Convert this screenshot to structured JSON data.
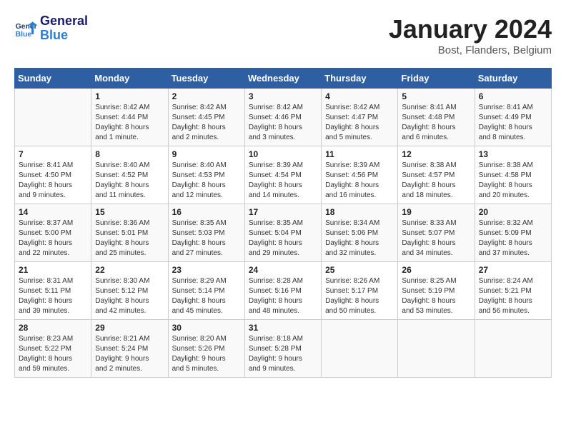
{
  "header": {
    "logo_line1": "General",
    "logo_line2": "Blue",
    "month_title": "January 2024",
    "subtitle": "Bost, Flanders, Belgium"
  },
  "days_of_week": [
    "Sunday",
    "Monday",
    "Tuesday",
    "Wednesday",
    "Thursday",
    "Friday",
    "Saturday"
  ],
  "weeks": [
    [
      {
        "day": "",
        "info": ""
      },
      {
        "day": "1",
        "info": "Sunrise: 8:42 AM\nSunset: 4:44 PM\nDaylight: 8 hours\nand 1 minute."
      },
      {
        "day": "2",
        "info": "Sunrise: 8:42 AM\nSunset: 4:45 PM\nDaylight: 8 hours\nand 2 minutes."
      },
      {
        "day": "3",
        "info": "Sunrise: 8:42 AM\nSunset: 4:46 PM\nDaylight: 8 hours\nand 3 minutes."
      },
      {
        "day": "4",
        "info": "Sunrise: 8:42 AM\nSunset: 4:47 PM\nDaylight: 8 hours\nand 5 minutes."
      },
      {
        "day": "5",
        "info": "Sunrise: 8:41 AM\nSunset: 4:48 PM\nDaylight: 8 hours\nand 6 minutes."
      },
      {
        "day": "6",
        "info": "Sunrise: 8:41 AM\nSunset: 4:49 PM\nDaylight: 8 hours\nand 8 minutes."
      }
    ],
    [
      {
        "day": "7",
        "info": "Sunrise: 8:41 AM\nSunset: 4:50 PM\nDaylight: 8 hours\nand 9 minutes."
      },
      {
        "day": "8",
        "info": "Sunrise: 8:40 AM\nSunset: 4:52 PM\nDaylight: 8 hours\nand 11 minutes."
      },
      {
        "day": "9",
        "info": "Sunrise: 8:40 AM\nSunset: 4:53 PM\nDaylight: 8 hours\nand 12 minutes."
      },
      {
        "day": "10",
        "info": "Sunrise: 8:39 AM\nSunset: 4:54 PM\nDaylight: 8 hours\nand 14 minutes."
      },
      {
        "day": "11",
        "info": "Sunrise: 8:39 AM\nSunset: 4:56 PM\nDaylight: 8 hours\nand 16 minutes."
      },
      {
        "day": "12",
        "info": "Sunrise: 8:38 AM\nSunset: 4:57 PM\nDaylight: 8 hours\nand 18 minutes."
      },
      {
        "day": "13",
        "info": "Sunrise: 8:38 AM\nSunset: 4:58 PM\nDaylight: 8 hours\nand 20 minutes."
      }
    ],
    [
      {
        "day": "14",
        "info": "Sunrise: 8:37 AM\nSunset: 5:00 PM\nDaylight: 8 hours\nand 22 minutes."
      },
      {
        "day": "15",
        "info": "Sunrise: 8:36 AM\nSunset: 5:01 PM\nDaylight: 8 hours\nand 25 minutes."
      },
      {
        "day": "16",
        "info": "Sunrise: 8:35 AM\nSunset: 5:03 PM\nDaylight: 8 hours\nand 27 minutes."
      },
      {
        "day": "17",
        "info": "Sunrise: 8:35 AM\nSunset: 5:04 PM\nDaylight: 8 hours\nand 29 minutes."
      },
      {
        "day": "18",
        "info": "Sunrise: 8:34 AM\nSunset: 5:06 PM\nDaylight: 8 hours\nand 32 minutes."
      },
      {
        "day": "19",
        "info": "Sunrise: 8:33 AM\nSunset: 5:07 PM\nDaylight: 8 hours\nand 34 minutes."
      },
      {
        "day": "20",
        "info": "Sunrise: 8:32 AM\nSunset: 5:09 PM\nDaylight: 8 hours\nand 37 minutes."
      }
    ],
    [
      {
        "day": "21",
        "info": "Sunrise: 8:31 AM\nSunset: 5:11 PM\nDaylight: 8 hours\nand 39 minutes."
      },
      {
        "day": "22",
        "info": "Sunrise: 8:30 AM\nSunset: 5:12 PM\nDaylight: 8 hours\nand 42 minutes."
      },
      {
        "day": "23",
        "info": "Sunrise: 8:29 AM\nSunset: 5:14 PM\nDaylight: 8 hours\nand 45 minutes."
      },
      {
        "day": "24",
        "info": "Sunrise: 8:28 AM\nSunset: 5:16 PM\nDaylight: 8 hours\nand 48 minutes."
      },
      {
        "day": "25",
        "info": "Sunrise: 8:26 AM\nSunset: 5:17 PM\nDaylight: 8 hours\nand 50 minutes."
      },
      {
        "day": "26",
        "info": "Sunrise: 8:25 AM\nSunset: 5:19 PM\nDaylight: 8 hours\nand 53 minutes."
      },
      {
        "day": "27",
        "info": "Sunrise: 8:24 AM\nSunset: 5:21 PM\nDaylight: 8 hours\nand 56 minutes."
      }
    ],
    [
      {
        "day": "28",
        "info": "Sunrise: 8:23 AM\nSunset: 5:22 PM\nDaylight: 8 hours\nand 59 minutes."
      },
      {
        "day": "29",
        "info": "Sunrise: 8:21 AM\nSunset: 5:24 PM\nDaylight: 9 hours\nand 2 minutes."
      },
      {
        "day": "30",
        "info": "Sunrise: 8:20 AM\nSunset: 5:26 PM\nDaylight: 9 hours\nand 5 minutes."
      },
      {
        "day": "31",
        "info": "Sunrise: 8:18 AM\nSunset: 5:28 PM\nDaylight: 9 hours\nand 9 minutes."
      },
      {
        "day": "",
        "info": ""
      },
      {
        "day": "",
        "info": ""
      },
      {
        "day": "",
        "info": ""
      }
    ]
  ]
}
